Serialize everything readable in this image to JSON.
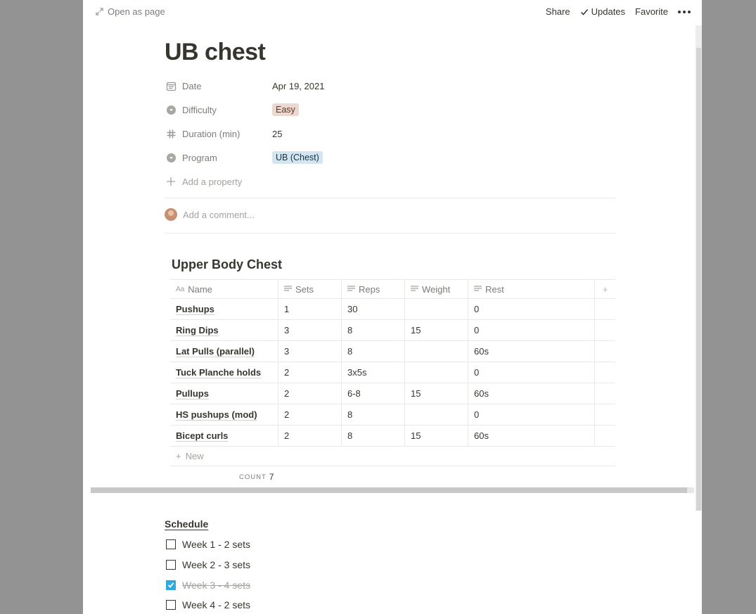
{
  "topbar": {
    "open_as_page": "Open as page",
    "share": "Share",
    "updates": "Updates",
    "favorite": "Favorite"
  },
  "page": {
    "title": "UB chest"
  },
  "properties": [
    {
      "name": "Date",
      "icon": "calendar-icon",
      "value": "Apr 19, 2021",
      "type": "date"
    },
    {
      "name": "Difficulty",
      "icon": "select-icon",
      "value": "Easy",
      "type": "select",
      "tag_color": "#ecd8cf"
    },
    {
      "name": "Duration (min)",
      "icon": "hash-icon",
      "value": "25",
      "type": "number"
    },
    {
      "name": "Program",
      "icon": "select-icon",
      "value": "UB (Chest)",
      "type": "select",
      "tag_color": "#d3e5ef"
    }
  ],
  "add_property": "Add a property",
  "comment": {
    "placeholder": "Add a comment..."
  },
  "database": {
    "title": "Upper Body Chest",
    "columns": [
      "Name",
      "Sets",
      "Reps",
      "Weight",
      "Rest"
    ],
    "rows": [
      {
        "name": "Pushups",
        "sets": "1",
        "reps": "30",
        "weight": "",
        "rest": "0"
      },
      {
        "name": "Ring Dips",
        "sets": "3",
        "reps": "8",
        "weight": "15",
        "rest": "0"
      },
      {
        "name": "Lat Pulls (parallel)",
        "sets": "3",
        "reps": "8",
        "weight": "",
        "rest": "60s"
      },
      {
        "name": "Tuck Planche holds",
        "sets": "2",
        "reps": "3x5s",
        "weight": "",
        "rest": "0"
      },
      {
        "name": "Pullups",
        "sets": "2",
        "reps": "6-8",
        "weight": "15",
        "rest": "60s"
      },
      {
        "name": "HS pushups (mod)",
        "sets": "2",
        "reps": "8",
        "weight": "",
        "rest": "0"
      },
      {
        "name": "Bicept curls",
        "sets": "2",
        "reps": "8",
        "weight": "15",
        "rest": "60s"
      }
    ],
    "new_label": "New",
    "count_label": "COUNT",
    "count_value": "7"
  },
  "schedule": {
    "title": "Schedule",
    "items": [
      {
        "label": "Week 1 - 2 sets",
        "checked": false
      },
      {
        "label": "Week 2 - 3 sets",
        "checked": false
      },
      {
        "label": "Week 3 - 4 sets",
        "checked": true
      },
      {
        "label": "Week 4 - 2 sets",
        "checked": false
      }
    ]
  },
  "colors": {
    "accent_checkbox": "#2eaadc",
    "text": "#37352f",
    "muted": "#7d7c78"
  }
}
